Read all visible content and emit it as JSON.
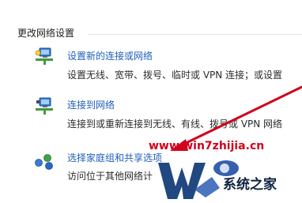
{
  "section": {
    "title": "更改网络设置"
  },
  "tasks": [
    {
      "icon": "network-setup-icon",
      "link": "设置新的连接或网络",
      "desc": "设置无线、宽带、拨号、临时或 VPN 连接；或设置"
    },
    {
      "icon": "network-connect-icon",
      "link": "连接到网络",
      "desc": "连接到或重新连接到无线、有线、拨号或 VPN 网络"
    },
    {
      "icon": "homegroup-icon",
      "link": "选择家庭组和共享选项",
      "desc": "访问位于其他网络计"
    }
  ],
  "watermark": {
    "url": "www.win7zhijia.cn",
    "brand": "系统之家",
    "color": "#d1001c"
  },
  "colors": {
    "link": "#1f5fb8",
    "arrow": "#d1001c"
  }
}
